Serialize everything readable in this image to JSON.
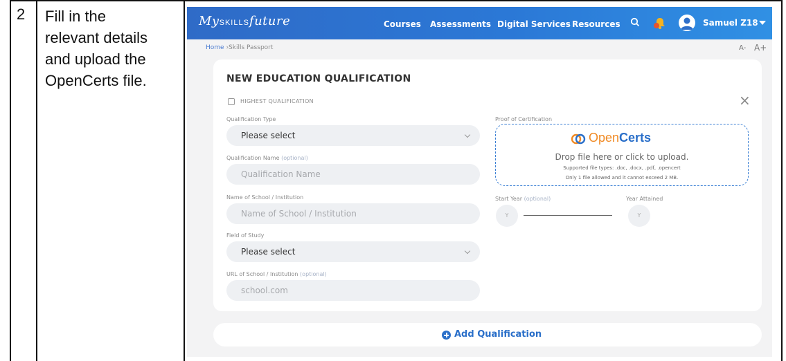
{
  "doc": {
    "step_number": "2",
    "instruction_lines": [
      "Fill in the",
      "relevant details",
      "and upload the",
      "OpenCerts file."
    ]
  },
  "app": {
    "logo_prefix": "My",
    "logo_skills": "SKILLS",
    "logo_suffix": "future",
    "nav": [
      "Courses",
      "Assessments",
      "Digital Services",
      "Resources"
    ],
    "user_name": "Samuel Z18",
    "brand_color": "#2e6ec9"
  },
  "breadcrumb": {
    "home": "Home",
    "separator": " ›",
    "current": "Skills Passport"
  },
  "font_size_controls": {
    "decrease": "A-",
    "increase": "A+"
  },
  "form": {
    "title": "NEW EDUCATION QUALIFICATION",
    "highest_label": "HIGHEST QUALIFICATION",
    "close_icon": "×",
    "qualification_type": {
      "label": "Qualification Type",
      "value": "Please select"
    },
    "qualification_name": {
      "label": "Qualification Name",
      "optional": "(optional)",
      "placeholder": "Qualification Name"
    },
    "school": {
      "label": "Name of School / Institution",
      "placeholder": "Name of School / Institution"
    },
    "field_of_study": {
      "label": "Field of Study",
      "value": "Please select"
    },
    "url": {
      "label": "URL of School / Institution",
      "optional": "(optional)",
      "placeholder": "school.com"
    },
    "proof": {
      "label": "Proof of Certification",
      "brand_open": "Open",
      "brand_certs": "Certs",
      "drop_text": "Drop file here or click to upload.",
      "types_text": "Supported file types: .doc, .docx, .pdf, .opencert",
      "limit_text": "Only 1 file allowed and it cannot exceed 2 MB."
    },
    "start_year": {
      "label": "Start Year",
      "optional": "(optional)",
      "placeholder": "Y"
    },
    "year_attained": {
      "label": "Year Attained",
      "placeholder": "Y"
    }
  },
  "add_button": {
    "label": "Add Qualification"
  }
}
